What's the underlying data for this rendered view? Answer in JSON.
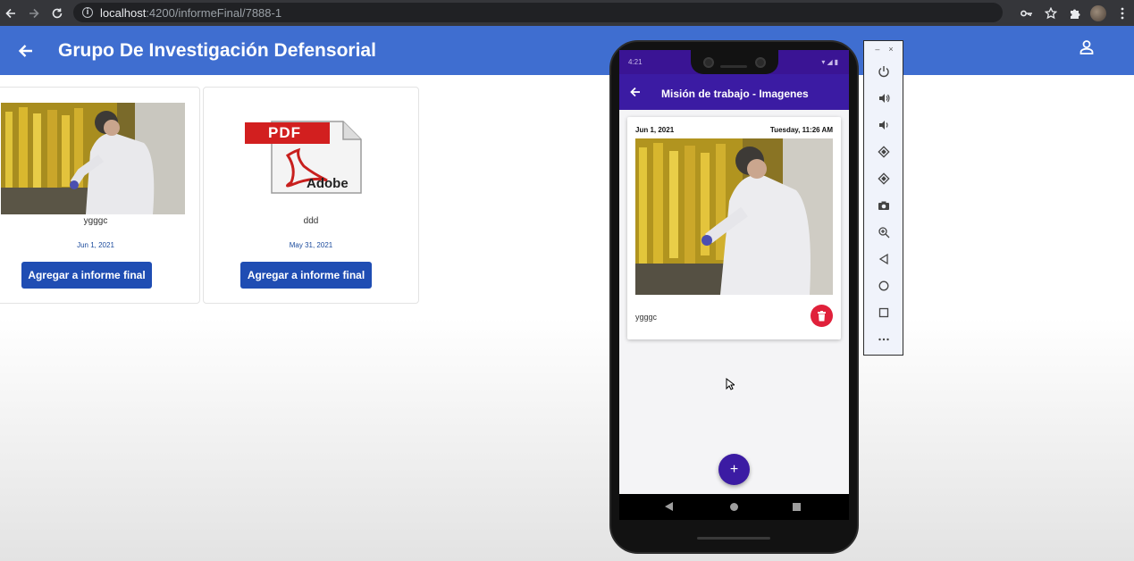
{
  "browser": {
    "url_host": "localhost",
    "url_path": ":4200/informeFinal/7888-1",
    "icons": [
      "back-icon",
      "forward-icon",
      "reload-icon",
      "info-icon",
      "key-icon",
      "star-icon",
      "extensions-icon",
      "menu-icon"
    ]
  },
  "header": {
    "title": "Grupo De Investigación Defensorial",
    "colors": {
      "background": "#3f6ed0",
      "text": "#ffffff"
    }
  },
  "cards": [
    {
      "type": "image",
      "caption": "ygggc",
      "date": "Jun 1, 2021",
      "button_label": "Agregar a informe final"
    },
    {
      "type": "pdf",
      "pdf_label": "PDF",
      "brand_label": "Adobe",
      "caption": "ddd",
      "date": "May 31, 2021",
      "button_label": "Agregar a informe final"
    }
  ],
  "phone": {
    "app_bar_title": "Misión de trabajo - Imagenes",
    "status_time": "4:21",
    "item": {
      "date_left": "Jun 1, 2021",
      "date_right": "Tuesday, 11:26 AM",
      "caption": "ygggc"
    },
    "fab_label": "+",
    "colors": {
      "app_bar": "#3b1ba3",
      "delete": "#e0203a"
    }
  },
  "emulator_toolbar": {
    "minimize": "–",
    "close": "×",
    "buttons": [
      "power-icon",
      "volume-up-icon",
      "volume-down-icon",
      "rotate-left-icon",
      "rotate-right-icon",
      "camera-icon",
      "zoom-icon",
      "back-icon",
      "home-icon",
      "overview-icon",
      "more-icon"
    ]
  }
}
